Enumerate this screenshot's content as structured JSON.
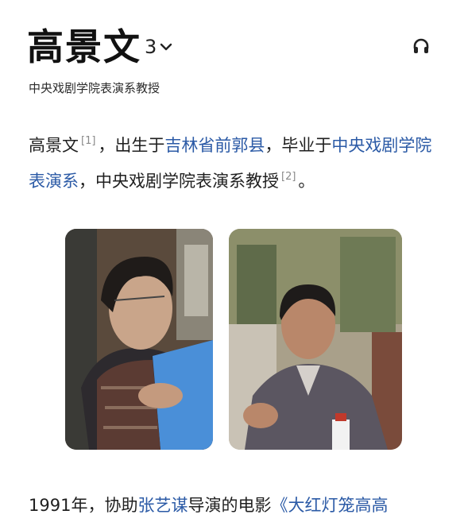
{
  "header": {
    "title": "高景文",
    "variant_count": "3",
    "subtitle": "中央戏剧学院表演系教授"
  },
  "intro": {
    "name": "高景文",
    "ref1": "[1]",
    "t1": "，出生于",
    "birthplace": "吉林省前郭县",
    "t2": "，毕业于",
    "school": "中央戏剧学院表演系",
    "t3": "，中央戏剧学院表演系教授",
    "ref2": "[2]",
    "t4": "。"
  },
  "paragraph2": {
    "year": "1991年，协助",
    "director": "张艺谋",
    "t1": "导演的电影",
    "film": "《大红灯笼高高"
  },
  "icons": {
    "variant": "chevron-down-icon",
    "audio": "headphones-icon"
  },
  "colors": {
    "link": "#2b5aa6",
    "text": "#1f1f1f"
  }
}
